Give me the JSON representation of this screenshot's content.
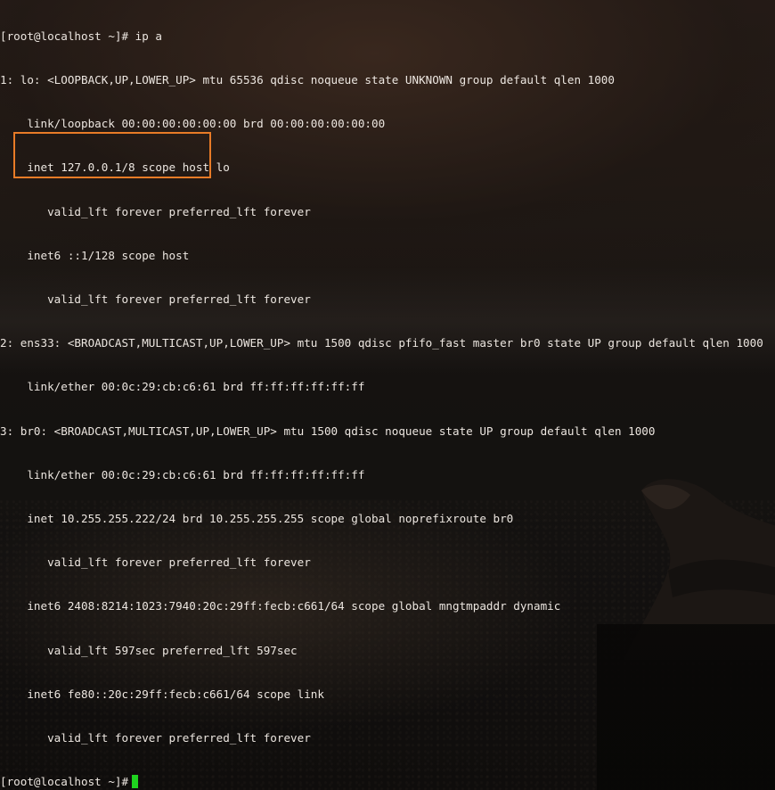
{
  "terminal": {
    "lines": [
      "[root@localhost ~]# ip a",
      "1: lo: <LOOPBACK,UP,LOWER_UP> mtu 65536 qdisc noqueue state UNKNOWN group default qlen 1000",
      "    link/loopback 00:00:00:00:00:00 brd 00:00:00:00:00:00",
      "    inet 127.0.0.1/8 scope host lo",
      "       valid_lft forever preferred_lft forever",
      "    inet6 ::1/128 scope host",
      "       valid_lft forever preferred_lft forever",
      "2: ens33: <BROADCAST,MULTICAST,UP,LOWER_UP> mtu 1500 qdisc pfifo_fast master br0 state UP group default qlen 1000",
      "    link/ether 00:0c:29:cb:c6:61 brd ff:ff:ff:ff:ff:ff",
      "3: br0: <BROADCAST,MULTICAST,UP,LOWER_UP> mtu 1500 qdisc noqueue state UP group default qlen 1000",
      "    link/ether 00:0c:29:cb:c6:61 brd ff:ff:ff:ff:ff:ff",
      "    inet 10.255.255.222/24 brd 10.255.255.255 scope global noprefixroute br0",
      "       valid_lft forever preferred_lft forever",
      "    inet6 2408:8214:1023:7940:20c:29ff:fecb:c661/64 scope global mngtmpaddr dynamic",
      "       valid_lft 597sec preferred_lft 597sec",
      "    inet6 fe80::20c:29ff:fecb:c661/64 scope link",
      "       valid_lft forever preferred_lft forever"
    ],
    "prompt": "[root@localhost ~]#"
  },
  "colors": {
    "text": "#ece6e0",
    "cursor": "#1fd41f",
    "highlight": "#e87b27"
  }
}
